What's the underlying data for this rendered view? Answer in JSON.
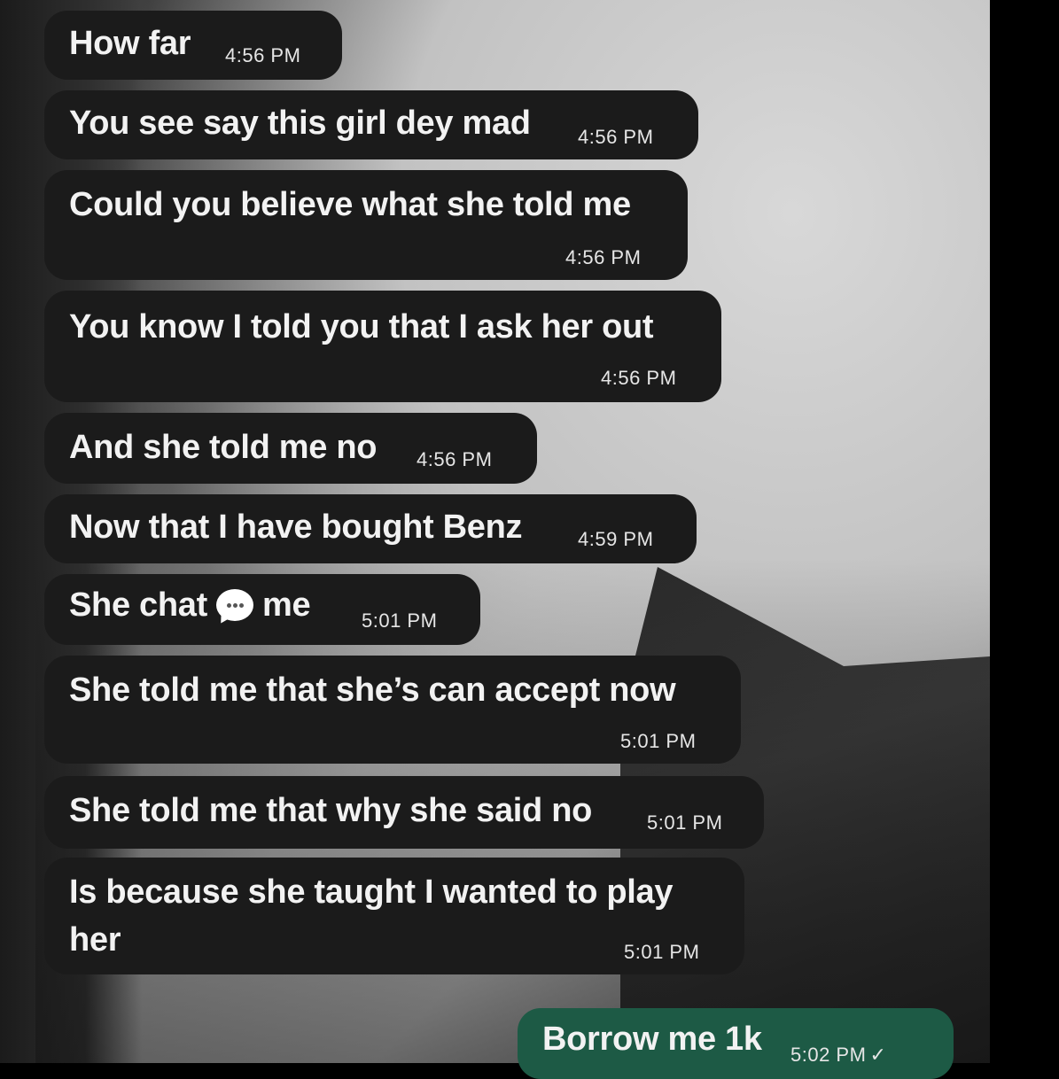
{
  "messages": [
    {
      "text": "How far",
      "time": "4:56 PM"
    },
    {
      "text": "You see say this girl dey mad",
      "time": "4:56 PM"
    },
    {
      "text": "Could you believe what she told me",
      "time": "4:56 PM"
    },
    {
      "text": "You know  I told you that I ask her out",
      "time": "4:56 PM"
    },
    {
      "text": "And she told me no",
      "time": "4:56 PM"
    },
    {
      "text": "Now that I have bought Benz",
      "time": "4:59 PM"
    },
    {
      "text_before": "She chat",
      "text_after": "me",
      "time": "5:01 PM",
      "icon": "speech-bubble-icon"
    },
    {
      "text": "She told me that she’s can accept now",
      "time": "5:01 PM"
    },
    {
      "text": "She told me that why she said no",
      "time": "5:01 PM"
    },
    {
      "text_line1": "Is because she taught I wanted to play",
      "text_line2": "her",
      "time": "5:01 PM"
    }
  ],
  "sent": {
    "text": "Borrow me 1k",
    "time": "5:02 PM",
    "status": "✓"
  },
  "colors": {
    "received_bubble": "#1b1b1b",
    "sent_bubble": "#1d5a45",
    "text": "#f2f2f2"
  }
}
